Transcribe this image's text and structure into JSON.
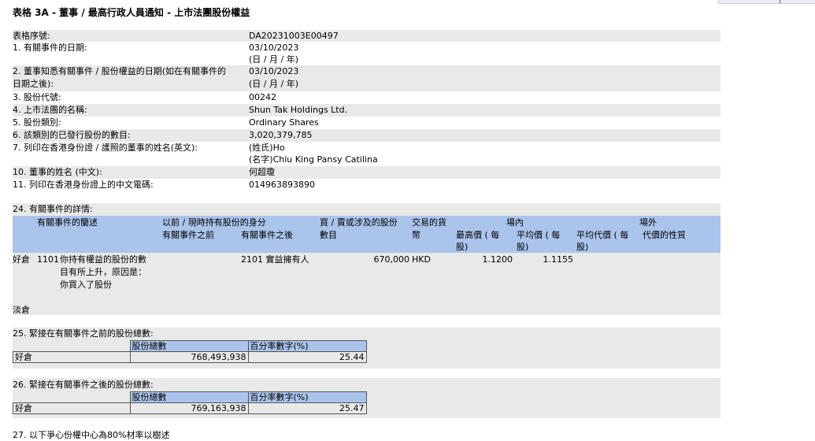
{
  "title": "表格 3A - 董事 / 最高行政人員通知 - 上市法團股份權益",
  "info_rows": [
    {
      "label": "表格序號:",
      "value": "DA20231003E00497"
    },
    {
      "label": "1. 有關事件的日期:",
      "value": "03/10/2023",
      "value2": "(日 / 月 / 年)"
    },
    {
      "label": "2. 董事知悉有關事件 / 股份權益的日期(如在有關事件的",
      "label2": "日期之後):",
      "value": "03/10/2023",
      "value2": "(日 / 月 / 年)"
    },
    {
      "label": "3. 股份代號:",
      "value": "00242"
    },
    {
      "label": "4. 上市法團的名稱:",
      "value": "Shun Tak Holdings Ltd."
    },
    {
      "label": "5. 股份類別:",
      "value": "Ordinary Shares"
    },
    {
      "label": "6. 該類別的已發行股份的數目:",
      "value": "3,020,379,785"
    },
    {
      "label": "7. 列印在香港身份證 / 護照的董事的姓名(英文):",
      "value": "(姓氏)Ho",
      "value2": "(名字)Chiu King Pansy Catilina"
    },
    {
      "label": "10. 董事的姓名 (中文):",
      "value": "何超瓊"
    },
    {
      "label": "11. 列印在香港身份證上的中文電碼:",
      "value": "014963893890"
    }
  ],
  "event": {
    "section_title": "24. 有關事件的詳情:",
    "headers": {
      "desc": "有關事件的籣述",
      "capacity": "以前 / 現時持有股份的身分",
      "cap_before": "有關事件之前",
      "cap_after": "有關事件之後",
      "shares_1": "買 / 賣或涉及的股份",
      "shares_2": "數目",
      "currency_1": "交易的貨",
      "currency_2": "幣",
      "onmarket": "場內",
      "high_1": "最高價 ( 每",
      "high_2": "股)",
      "avg_1": "平均價 ( 每",
      "avg_2": "股)",
      "offmarket": "場外",
      "offavg_1": "平均代價 ( 每",
      "offavg_2": "股)",
      "nature": "代價的性質"
    },
    "row": {
      "position": "好倉",
      "code": "1101",
      "desc_1": "你持有權益的股份的數",
      "desc_2": "目有所上升，原因是：",
      "desc_3": "你買入了股份",
      "cap_after": "2101 實益擁有人",
      "shares": "670,000",
      "currency": "HKD",
      "high": "1.1200",
      "avg": "1.1155"
    },
    "short": "淡倉"
  },
  "total_before": {
    "section_title": "25. 緊接在有關事件之前的股份總數:",
    "col_shares": "股份總數",
    "col_pct": "百分率數字(%)",
    "row_label": "好倉",
    "shares": "768,493,938",
    "pct": "25.44"
  },
  "total_after": {
    "section_title": "26. 緊接在有關事件之後的股份總數:",
    "col_shares": "股份總數",
    "col_pct": "百分率數字(%)",
    "row_label": "好倉",
    "shares": "769,163,938",
    "pct": "25.47"
  },
  "footer_partial": "27. 以下爭心份權中心為80%材率以樹述"
}
